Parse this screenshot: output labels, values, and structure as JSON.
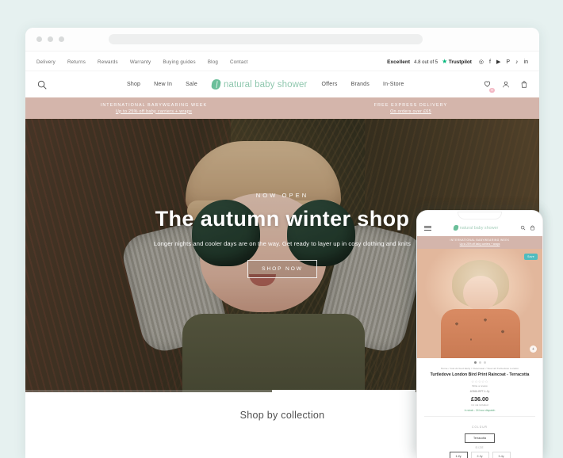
{
  "browser": {
    "dots": [
      "close",
      "minimize",
      "maximize"
    ],
    "url_placeholder": ""
  },
  "site": {
    "utility_links": [
      "Delivery",
      "Returns",
      "Rewards",
      "Warranty",
      "Buying guides",
      "Blog",
      "Contact"
    ],
    "trustpilot": {
      "rating_word": "Excellent",
      "score_text": "4.8 out of 5",
      "star": "★",
      "brand": "Trustpilot"
    },
    "socials": [
      {
        "name": "instagram-icon",
        "glyph": "◎"
      },
      {
        "name": "facebook-icon",
        "glyph": "f"
      },
      {
        "name": "youtube-icon",
        "glyph": "▶"
      },
      {
        "name": "pinterest-icon",
        "glyph": "P"
      },
      {
        "name": "tiktok-icon",
        "glyph": "♪"
      },
      {
        "name": "linkedin-icon",
        "glyph": "in"
      }
    ],
    "nav_left": [
      "Shop",
      "New In",
      "Sale"
    ],
    "nav_right": [
      "Offers",
      "Brands",
      "In-Store"
    ],
    "logo_text": "natural baby shower",
    "wishlist_count": "0",
    "promo": [
      {
        "title": "INTERNATIONAL BABYWEARING WEEK",
        "sub": "Up to 25% off baby carriers + wraps"
      },
      {
        "title": "FREE EXPRESS DELIVERY",
        "sub": "On orders over £65"
      }
    ]
  },
  "hero": {
    "eyebrow": "NOW OPEN",
    "title": "The autumn winter shop",
    "subtitle": "Longer nights and cooler days are on the way. Get ready to layer up in cosy clothing and knits",
    "cta": "SHOP NOW"
  },
  "collection": {
    "heading": "Shop by collection"
  },
  "phone": {
    "logo_text": "natural baby shower",
    "promo_title": "INTERNATIONAL BABYWEARING WEEK",
    "promo_sub": "Up to 25% off baby carriers + wraps",
    "save_badge": "Save",
    "breadcrumb": "Home / Just Arrived Early / Outerwear / View all Turtledove London",
    "product_title": "Turtledove London Bird Print Raincoat - Terracotta",
    "stars": "☆☆☆☆☆",
    "reviews": "Write a review",
    "sku": "40366-BPT-1-2y",
    "price": "£36.00",
    "vat_note": "inc vat included",
    "stock": "In stock - 24 hour dispatch",
    "colour_label": "COLOUR",
    "colour_value": "Terracotta",
    "size_label": "SIZE",
    "sizes": [
      "1-2y",
      "2-3y",
      "3-4y"
    ],
    "selected_size": "1-2y"
  },
  "colors": {
    "page_bg": "#e6f1f0",
    "promo_bg": "#d4b5ab",
    "brand_green": "#8fc7ae",
    "trustpilot_green": "#00b67a",
    "save_teal": "#4fbcbf",
    "wishlist_pink": "#f3b8c4"
  }
}
